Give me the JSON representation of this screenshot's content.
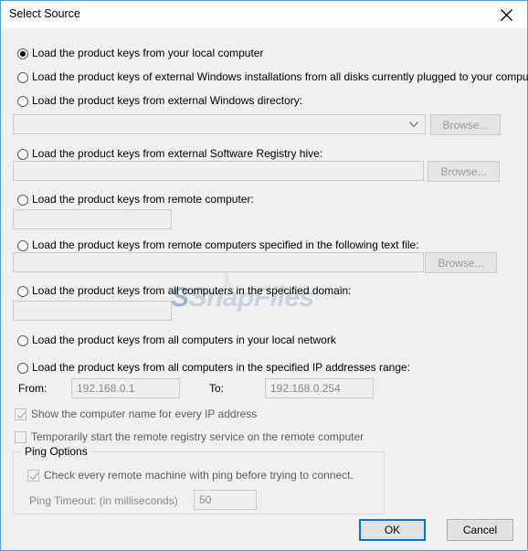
{
  "window": {
    "title": "Select Source",
    "close_icon": "close-icon",
    "border_color": "#5c9ccc",
    "background": "#f0f0f0"
  },
  "watermark": {
    "text_prefix": "S",
    "text": "SnapFiles",
    "color": "#c8d3de"
  },
  "options": [
    {
      "id": "local-computer",
      "label": "Load the product keys from your local computer",
      "selected": true
    },
    {
      "id": "external-windows-installations",
      "label": "Load the product keys of external Windows installations from all disks currently plugged to your computer",
      "selected": false
    },
    {
      "id": "external-windows-directory",
      "label": "Load the product keys from external Windows directory:",
      "selected": false
    },
    {
      "id": "external-registry-hive",
      "label": "Load the product keys from external Software Registry hive:",
      "selected": false
    },
    {
      "id": "remote-computer",
      "label": "Load the product keys from remote computer:",
      "selected": false
    },
    {
      "id": "remote-computers-text-file",
      "label": "Load the product keys from remote computers specified in the following text file:",
      "selected": false
    },
    {
      "id": "specified-domain",
      "label": "Load the product keys from all computers in the specified domain:",
      "selected": false
    },
    {
      "id": "local-network",
      "label": "Load the product keys from all computers in your local network",
      "selected": false
    },
    {
      "id": "ip-addresses-range",
      "label": "Load the product keys from all computers in the specified IP addresses range:",
      "selected": false
    }
  ],
  "fields": {
    "windows_directory": {
      "value": "",
      "placeholder": ""
    },
    "registry_hive": {
      "value": "",
      "placeholder": ""
    },
    "remote_computer": {
      "value": "",
      "placeholder": ""
    },
    "text_file": {
      "value": "",
      "placeholder": ""
    },
    "domain": {
      "value": "",
      "placeholder": ""
    },
    "ip_from": {
      "value": "192.168.0.1",
      "placeholder": ""
    },
    "ip_to": {
      "value": "192.168.0.254",
      "placeholder": ""
    },
    "ping_timeout": {
      "value": "50",
      "placeholder": ""
    }
  },
  "labels": {
    "browse": "Browse...",
    "from": "From:",
    "to": "To:",
    "ping_timeout": "Ping Timeout: (in milliseconds)"
  },
  "checkboxes": [
    {
      "id": "show-computer-name",
      "label": "Show the computer name for every IP address",
      "checked": true,
      "enabled": false
    },
    {
      "id": "start-remote-registry",
      "label": "Temporarily start the remote registry service on the remote computer",
      "checked": false,
      "enabled": false
    },
    {
      "id": "check-with-ping",
      "label": "Check every remote machine with ping before trying to connect.",
      "checked": true,
      "enabled": false
    }
  ],
  "ping_options": {
    "title": "Ping Options"
  },
  "buttons": {
    "ok": "OK",
    "cancel": "Cancel",
    "ok_accent": "#0078d7"
  }
}
